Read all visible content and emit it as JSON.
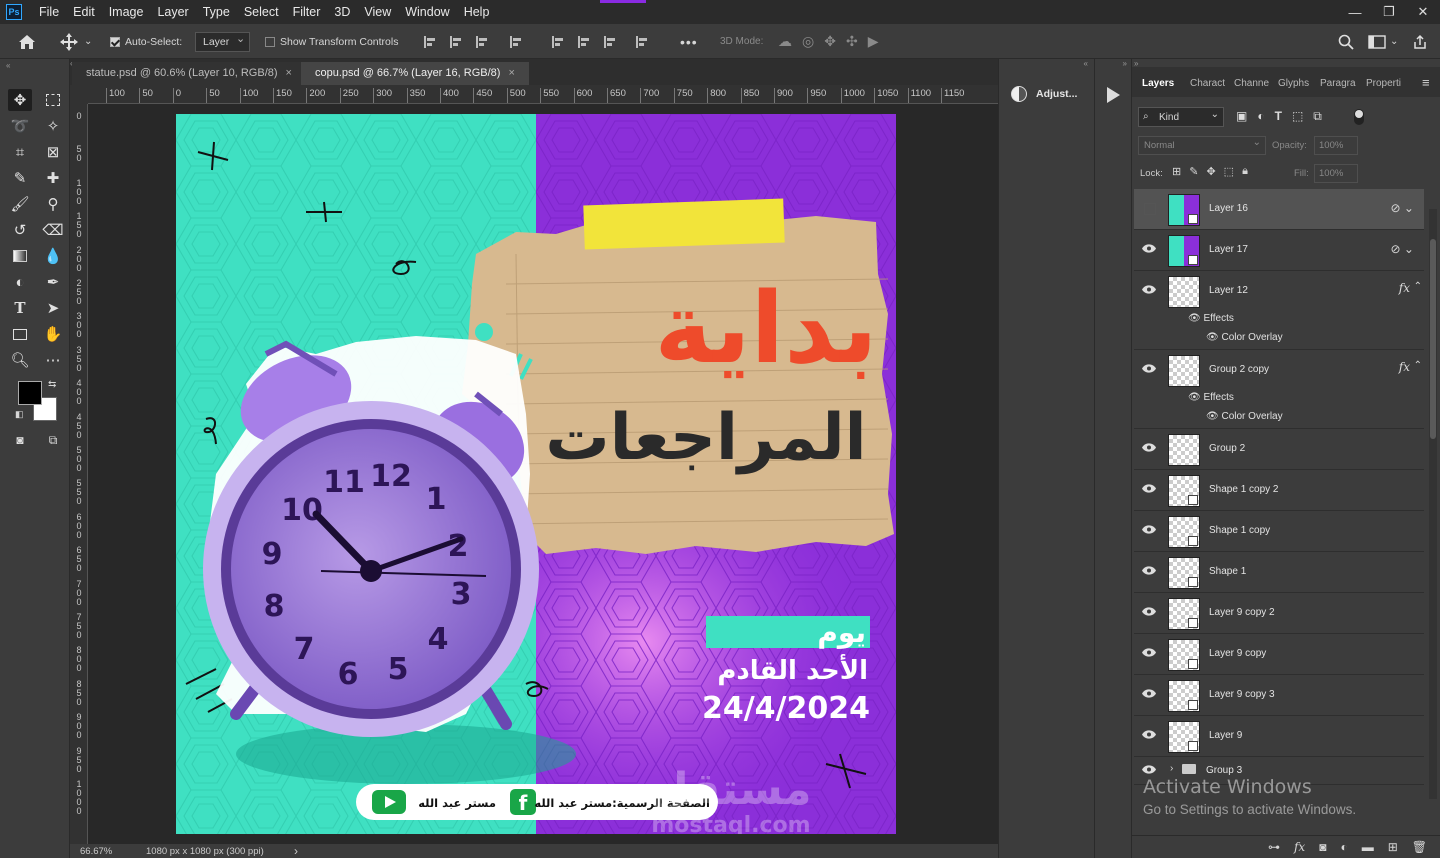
{
  "menubar": {
    "logo": "Ps",
    "items": [
      "File",
      "Edit",
      "Image",
      "Layer",
      "Type",
      "Select",
      "Filter",
      "3D",
      "View",
      "Window",
      "Help"
    ]
  },
  "options": {
    "auto_select_label": "Auto-Select:",
    "auto_select_value": "Layer",
    "transform_controls_label": "Show Transform Controls",
    "mode_3d_label": "3D Mode:"
  },
  "tabs": [
    {
      "label": "statue.psd @ 60.6% (Layer 10, RGB/8)",
      "active": false
    },
    {
      "label": "copu.psd @ 66.7% (Layer 16, RGB/8)",
      "active": true
    }
  ],
  "ruler": {
    "h_ticks": [
      "100",
      "50",
      "0",
      "50",
      "100",
      "150",
      "200",
      "250",
      "300",
      "350",
      "400",
      "450",
      "500",
      "550",
      "600",
      "650",
      "700",
      "750",
      "800",
      "850",
      "900",
      "950",
      "1000",
      "1050",
      "1100",
      "1150"
    ],
    "v_ticks": [
      "0",
      "5\n0",
      "1\n0\n0",
      "1\n5\n0",
      "2\n0\n0",
      "2\n5\n0",
      "3\n0\n0",
      "3\n5\n0",
      "4\n0\n0",
      "4\n5\n0",
      "5\n0\n0",
      "5\n5\n0",
      "6\n0\n0",
      "6\n5\n0",
      "7\n0\n0",
      "7\n5\n0",
      "8\n0\n0",
      "8\n5\n0",
      "9\n0\n0",
      "9\n5\n0",
      "1\n0\n0\n0"
    ]
  },
  "artwork": {
    "title_line1": "بداية",
    "title_line2": "المراجعات",
    "day_label": "يوم",
    "day_name": "الأحد القادم",
    "date": "24/4/2024",
    "footer_fb": "الصفحة الرسمية:مستر عبد الله",
    "footer_yt": "مستر عبد الله",
    "clock_numbers": [
      "12",
      "1",
      "2",
      "3",
      "4",
      "5",
      "6",
      "7",
      "8",
      "9",
      "10",
      "11"
    ]
  },
  "status": {
    "zoom": "66.67%",
    "doc_size": "1080 px x 1080 px (300 ppi)",
    "arrow": "›"
  },
  "adjust_panel": {
    "label": "Adjust..."
  },
  "layers_panel": {
    "tabs": [
      "Layers",
      "Charact",
      "Channe",
      "Glyphs",
      "Paragra",
      "Properti"
    ],
    "filter_label": "Kind",
    "blend_mode": "Normal",
    "opacity_label": "Opacity:",
    "opacity_value": "100%",
    "lock_label": "Lock:",
    "fill_label": "Fill:",
    "fill_value": "100%",
    "layers": [
      {
        "name": "Layer 16",
        "visible": false,
        "fx": false
      },
      {
        "name": "Layer 17",
        "visible": true,
        "fx": false
      },
      {
        "name": "Layer 12",
        "visible": true,
        "fx": true
      },
      {
        "name": "Group 2 copy",
        "visible": true,
        "fx": true
      },
      {
        "name": "Group 2",
        "visible": true,
        "fx": false
      },
      {
        "name": "Shape  1 copy 2",
        "visible": true,
        "fx": false
      },
      {
        "name": "Shape  1 copy",
        "visible": true,
        "fx": false
      },
      {
        "name": "Shape  1",
        "visible": true,
        "fx": false
      },
      {
        "name": "Layer 9 copy 2",
        "visible": true,
        "fx": false
      },
      {
        "name": "Layer 9 copy",
        "visible": true,
        "fx": false
      },
      {
        "name": "Layer 9 copy 3",
        "visible": true,
        "fx": false
      },
      {
        "name": "Layer 9",
        "visible": true,
        "fx": false
      }
    ],
    "effects_label": "Effects",
    "color_overlay_label": "Color Overlay",
    "fx_label": "fx",
    "group3": "Group 3"
  },
  "watermark": {
    "line1": "Activate Windows",
    "line2": "Go to Settings to activate Windows.",
    "site_ar": "مستقل",
    "site_en": "mostaql.com"
  },
  "colors": {
    "teal": "#3fe0c2",
    "purple": "#8b2fd9",
    "red_text": "#ee4b2b",
    "dark_text": "#2a2a2a"
  }
}
